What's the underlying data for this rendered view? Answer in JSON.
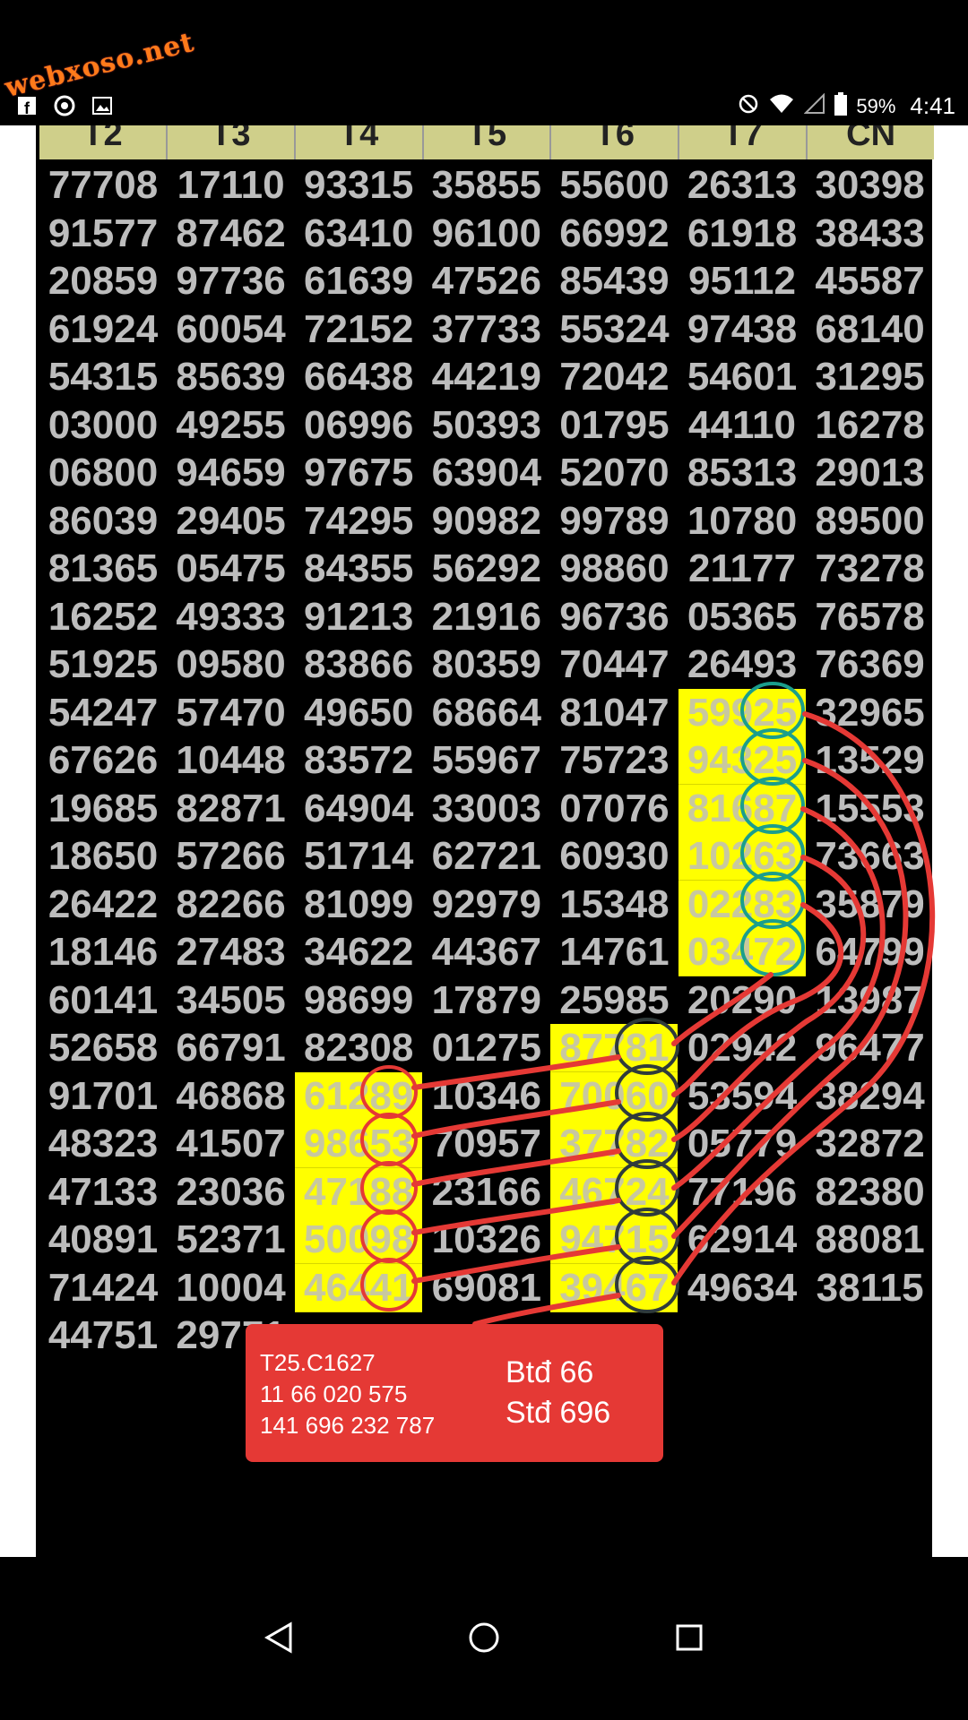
{
  "status_bar": {
    "watermark": "webxoso.net",
    "left_icons": [
      "facebook-icon",
      "chrome-icon",
      "image-icon"
    ],
    "right_icons": [
      "do-not-disturb-icon",
      "wifi-icon",
      "signal-icon",
      "battery-icon"
    ],
    "battery": "59%",
    "time": "4:41"
  },
  "table": {
    "headers": [
      "T2",
      "T3",
      "T4",
      "T5",
      "T6",
      "T7",
      "CN"
    ],
    "rows": [
      [
        "77708",
        "17110",
        "93315",
        "35855",
        "55600",
        "26313",
        "30398"
      ],
      [
        "91577",
        "87462",
        "63410",
        "96100",
        "66992",
        "61918",
        "38433"
      ],
      [
        "20859",
        "97736",
        "61639",
        "47526",
        "85439",
        "95112",
        "45587"
      ],
      [
        "61924",
        "60054",
        "72152",
        "37733",
        "55324",
        "97438",
        "68140"
      ],
      [
        "54315",
        "85639",
        "66438",
        "44219",
        "72042",
        "54601",
        "31295"
      ],
      [
        "03000",
        "49255",
        "06996",
        "50393",
        "01795",
        "44110",
        "16278"
      ],
      [
        "06800",
        "94659",
        "97675",
        "63904",
        "52070",
        "85313",
        "29013"
      ],
      [
        "86039",
        "29405",
        "74295",
        "90982",
        "99789",
        "10780",
        "89500"
      ],
      [
        "81365",
        "05475",
        "84355",
        "56292",
        "98860",
        "21177",
        "73278"
      ],
      [
        "16252",
        "49333",
        "91213",
        "21916",
        "96736",
        "05365",
        "76578"
      ],
      [
        "51925",
        "09580",
        "83866",
        "80359",
        "70447",
        "26493",
        "76369"
      ],
      [
        "54247",
        "57470",
        "49650",
        "68664",
        "81047",
        "59925",
        "32965"
      ],
      [
        "67626",
        "10448",
        "83572",
        "55967",
        "75723",
        "94325",
        "13529"
      ],
      [
        "19685",
        "82871",
        "64904",
        "33003",
        "07076",
        "81687",
        "15553"
      ],
      [
        "18650",
        "57266",
        "51714",
        "62721",
        "60930",
        "10263",
        "73663"
      ],
      [
        "26422",
        "82266",
        "81099",
        "92979",
        "15348",
        "02283",
        "35879"
      ],
      [
        "18146",
        "27483",
        "34622",
        "44367",
        "14761",
        "03472",
        "64799"
      ],
      [
        "60141",
        "34505",
        "98699",
        "17879",
        "25985",
        "20290",
        "13987"
      ],
      [
        "52658",
        "66791",
        "82308",
        "01275",
        "87781",
        "02942",
        "96477"
      ],
      [
        "91701",
        "46868",
        "61289",
        "10346",
        "70060",
        "53594",
        "38294"
      ],
      [
        "48323",
        "41507",
        "98653",
        "70957",
        "37782",
        "05779",
        "32872"
      ],
      [
        "47133",
        "23036",
        "47188",
        "23166",
        "46724",
        "77196",
        "82380"
      ],
      [
        "40891",
        "52371",
        "50098",
        "10326",
        "94715",
        "62914",
        "88081"
      ],
      [
        "71424",
        "10004",
        "46441",
        "69081",
        "39467",
        "49634",
        "38115"
      ],
      [
        "44751",
        "29771",
        "",
        "",
        "",
        "",
        ""
      ]
    ],
    "highlights": [
      {
        "col": 2,
        "rows": [
          19,
          20,
          21,
          22,
          23
        ]
      },
      {
        "col": 4,
        "rows": [
          18,
          19,
          20,
          21,
          22,
          23
        ]
      },
      {
        "col": 5,
        "rows": [
          11,
          12,
          13,
          14,
          15,
          16
        ]
      }
    ]
  },
  "annotation": {
    "line1": "T25.C1627",
    "line2": "11 66 020 575",
    "line3": "141 696 232 787",
    "right1": "Btđ 66",
    "right2": "Stđ 696"
  },
  "colors": {
    "highlight": "#ffff00",
    "digits": "#bdbdbd",
    "red_marker": "#e53935",
    "teal_marker": "#1a9e8c",
    "dark_marker": "#2f3b3b"
  },
  "nav_bar": {
    "back": "back-icon",
    "home": "home-icon",
    "recents": "recents-icon"
  }
}
